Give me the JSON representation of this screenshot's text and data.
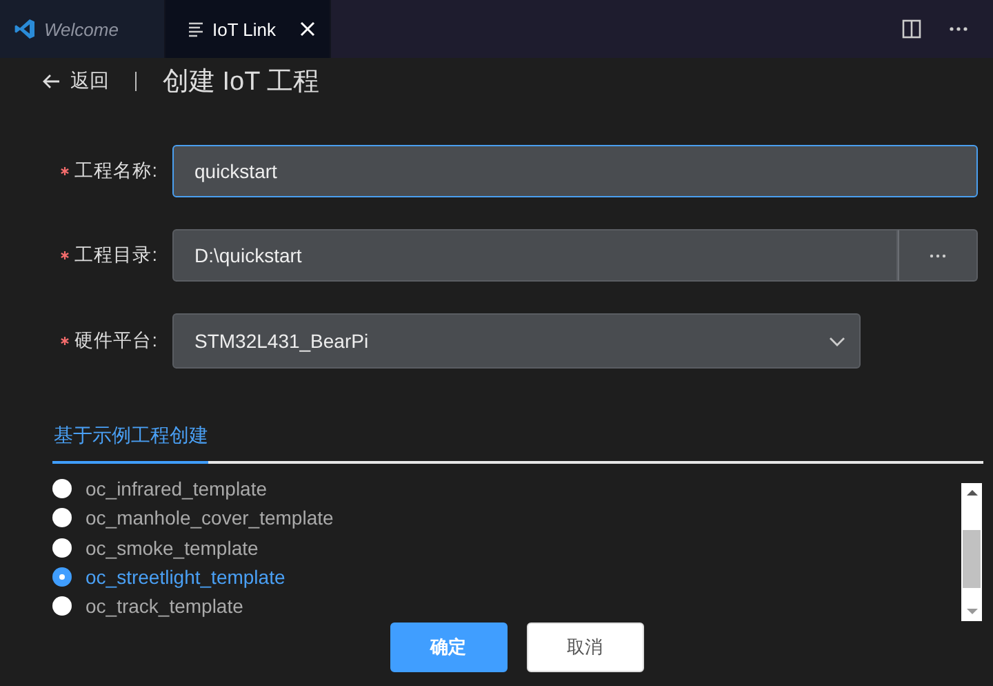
{
  "tabs": [
    {
      "label": "Welcome",
      "kind": "welcome",
      "selected": false
    },
    {
      "label": "IoT Link",
      "kind": "doc",
      "selected": true,
      "closable": true
    }
  ],
  "header": {
    "back": "返回",
    "title": "创建 IoT 工程"
  },
  "form": [
    {
      "label": "工程名称:",
      "required": true,
      "kind": "text",
      "value": "quickstart",
      "focused": true
    },
    {
      "label": "工程目录:",
      "required": true,
      "kind": "browse",
      "value": "D:\\quickstart",
      "focused": false
    },
    {
      "label": "硬件平台:",
      "required": true,
      "kind": "select",
      "value": "STM32L431_BearPi",
      "focused": false
    }
  ],
  "section_tabs": [
    {
      "label": "基于示例工程创建",
      "selected": true
    }
  ],
  "templates": [
    {
      "label": "oc_infrared_template",
      "selected": false
    },
    {
      "label": "oc_manhole_cover_template",
      "selected": false
    },
    {
      "label": "oc_smoke_template",
      "selected": false
    },
    {
      "label": "oc_streetlight_template",
      "selected": true
    },
    {
      "label": "oc_track_template",
      "selected": false
    }
  ],
  "buttons": [
    {
      "label": "确定",
      "kind": "primary"
    },
    {
      "label": "取消",
      "kind": "secondary"
    }
  ]
}
